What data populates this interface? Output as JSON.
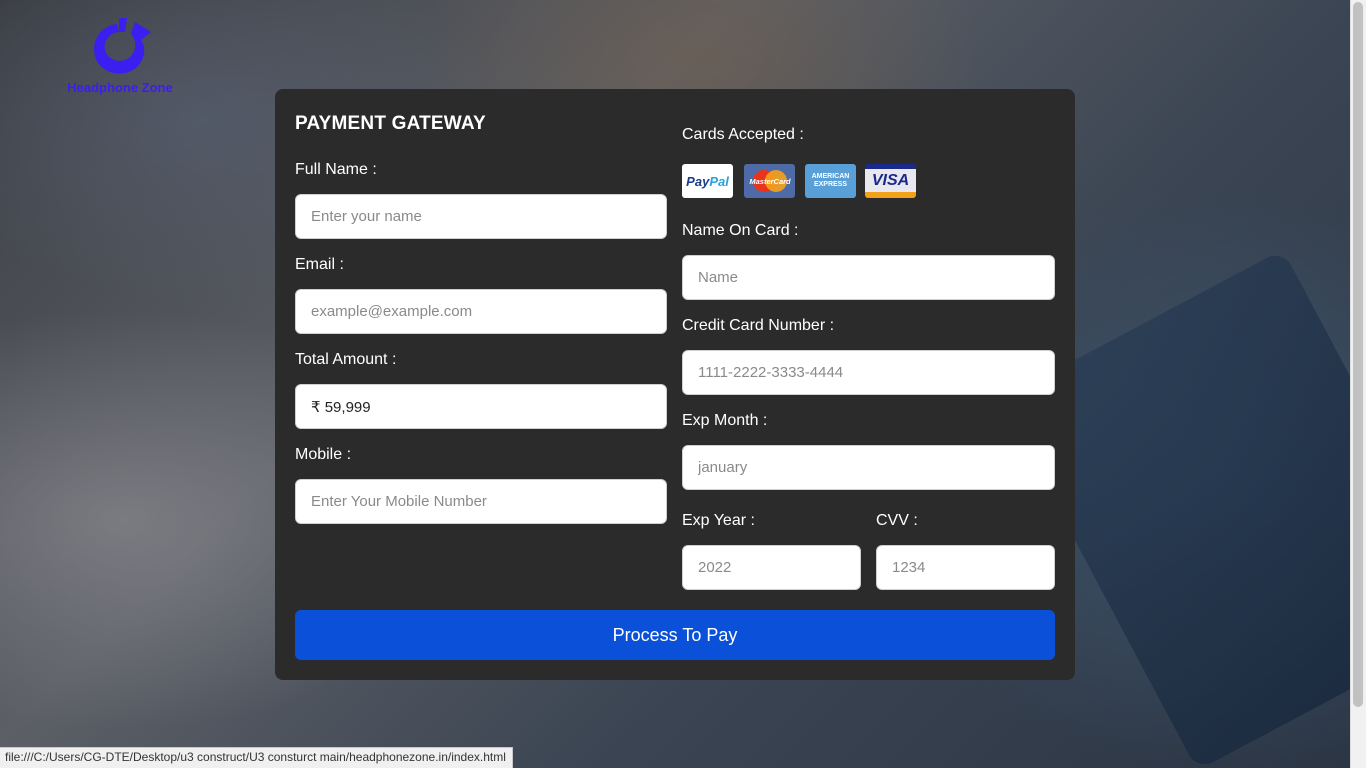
{
  "brand": {
    "name": "Headphone Zone",
    "color": "#3b1ef0"
  },
  "form": {
    "title": "PAYMENT GATEWAY",
    "full_name": {
      "label": "Full Name :",
      "placeholder": "Enter your name"
    },
    "email": {
      "label": "Email :",
      "placeholder": "example@example.com"
    },
    "amount": {
      "label": "Total Amount :",
      "value": "₹ 59,999"
    },
    "mobile": {
      "label": "Mobile :",
      "placeholder": "Enter Your Mobile Number"
    },
    "cards_accepted": {
      "label": "Cards Accepted :",
      "icons": [
        "paypal-icon",
        "mastercard-icon",
        "american-express-icon",
        "visa-icon"
      ],
      "paypal_text_a": "Pay",
      "paypal_text_b": "Pal",
      "mastercard_text": "MasterCard",
      "amex_text": "AMERICAN EXPRESS",
      "visa_text": "VISA"
    },
    "name_on_card": {
      "label": "Name On Card :",
      "placeholder": "Name"
    },
    "card_number": {
      "label": "Credit Card Number :",
      "placeholder": "1111-2222-3333-4444"
    },
    "exp_month": {
      "label": "Exp Month :",
      "placeholder": "january"
    },
    "exp_year": {
      "label": "Exp Year :",
      "placeholder": "2022"
    },
    "cvv": {
      "label": "CVV :",
      "placeholder": "1234"
    },
    "submit_label": "Process To Pay",
    "submit_color": "#0b50d8"
  },
  "status_bar": {
    "url": "file:///C:/Users/CG-DTE/Desktop/u3 construct/U3 consturct main/headphonezone.in/index.html"
  }
}
